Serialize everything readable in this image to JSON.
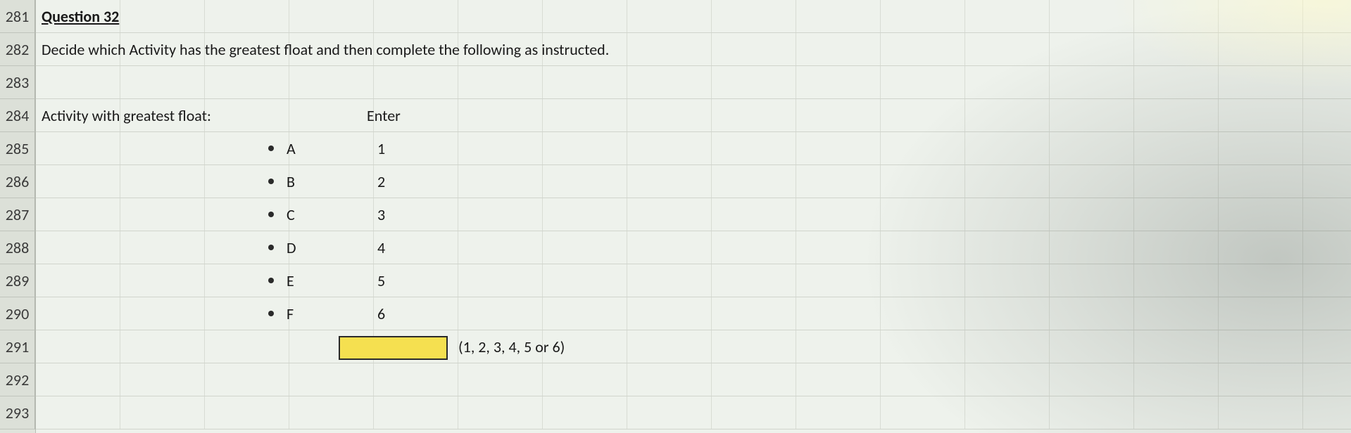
{
  "rows": {
    "start": 281,
    "labels": [
      "281",
      "282",
      "283",
      "284",
      "285",
      "286",
      "287",
      "288",
      "289",
      "290",
      "291",
      "292",
      "293"
    ]
  },
  "question": {
    "title": "Question 32",
    "instruction": "Decide which Activity has the greatest float and then complete the following as instructed.",
    "prompt": "Activity with greatest float:",
    "enterLabel": "Enter"
  },
  "options": [
    {
      "letter": "A",
      "value": "1"
    },
    {
      "letter": "B",
      "value": "2"
    },
    {
      "letter": "C",
      "value": "3"
    },
    {
      "letter": "D",
      "value": "4"
    },
    {
      "letter": "E",
      "value": "5"
    },
    {
      "letter": "F",
      "value": "6"
    }
  ],
  "answer": {
    "hint": "(1, 2, 3, 4, 5 or 6)"
  }
}
